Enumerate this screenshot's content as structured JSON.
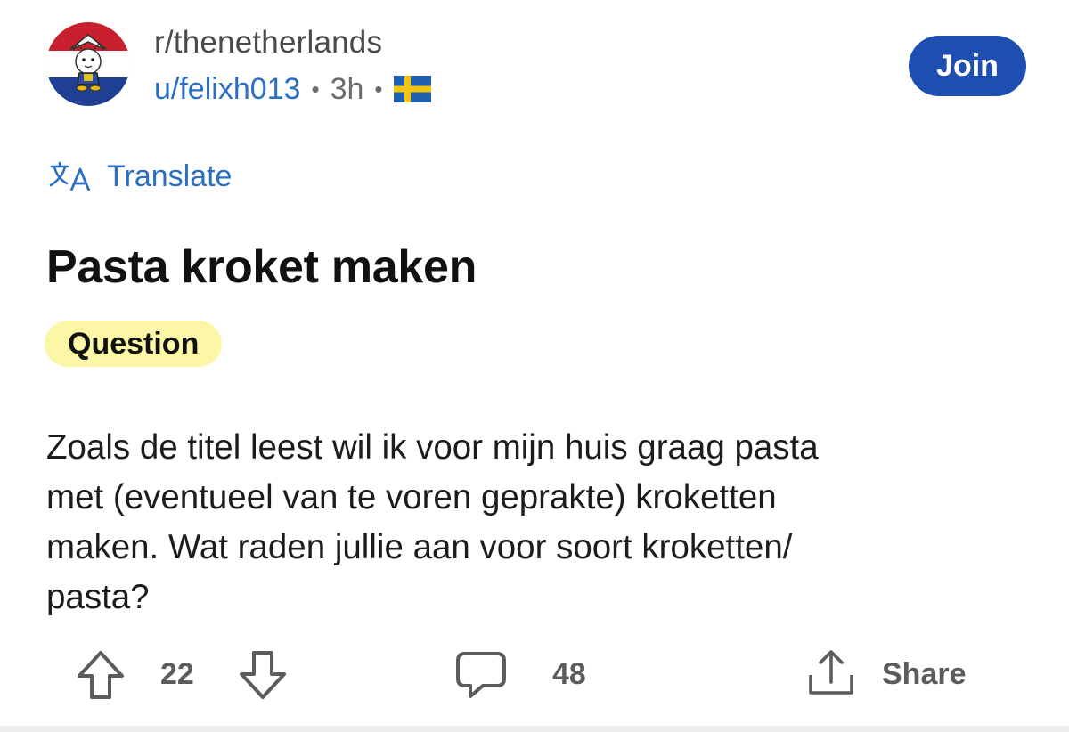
{
  "header": {
    "subreddit": "r/thenetherlands",
    "username": "u/felixh013",
    "separator": "•",
    "time_ago": "3h",
    "user_flair_icon": "sweden-flag-icon",
    "join_label": "Join"
  },
  "translate": {
    "label": "Translate",
    "icon": "translate-icon"
  },
  "post": {
    "title": "Pasta kroket maken",
    "flair": "Question",
    "body_lines": [
      "Zoals de titel leest wil ik voor mijn huis graag pasta",
      "met (eventueel van te voren geprakte) kroketten",
      "maken. Wat raden jullie aan voor soort kroketten/",
      "pasta?"
    ]
  },
  "actions": {
    "upvote_icon": "upvote-arrow-icon",
    "score": "22",
    "downvote_icon": "downvote-arrow-icon",
    "comment_icon": "comment-bubble-icon",
    "comment_count": "48",
    "share_icon": "share-icon",
    "share_label": "Share"
  },
  "colors": {
    "link_blue": "#2a6fc4",
    "join_button": "#1e4fb0",
    "flair_background": "#fcf7a6",
    "action_gray": "#5c5c5c"
  }
}
